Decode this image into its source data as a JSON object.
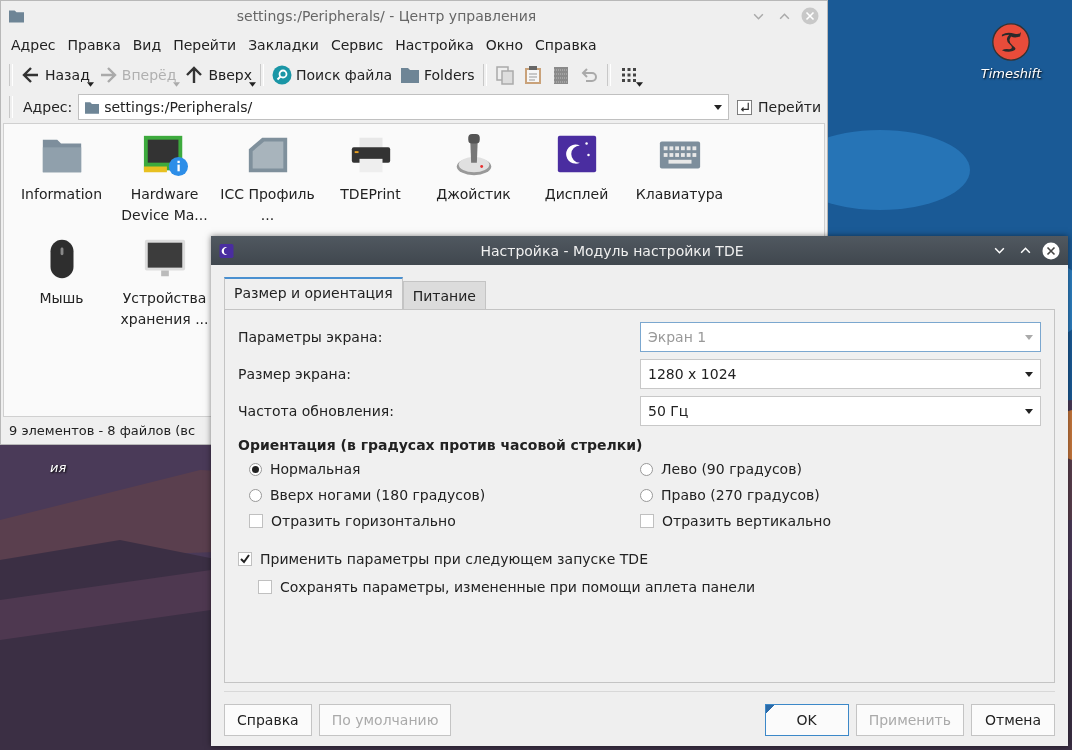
{
  "desktop": {
    "icons": [
      {
        "label": "Timeshift"
      }
    ],
    "partial_label": "ия"
  },
  "main_window": {
    "title": "settings:/Peripherals/ - Центр управления",
    "menu": [
      "Адрес",
      "Правка",
      "Вид",
      "Перейти",
      "Закладки",
      "Сервис",
      "Настройка",
      "Окно",
      "Справка"
    ],
    "toolbar_groups": [
      [
        {
          "kind": "back",
          "label": "Назад",
          "disabled": false,
          "dropdown": true
        },
        {
          "kind": "forward",
          "label": "Вперёд",
          "disabled": true,
          "dropdown": true
        },
        {
          "kind": "up",
          "label": "Вверх",
          "disabled": false,
          "dropdown": true
        }
      ],
      [
        {
          "kind": "search",
          "label": "Поиск файла",
          "disabled": false,
          "dropdown": false
        },
        {
          "kind": "folders",
          "label": "Folders",
          "disabled": false,
          "dropdown": false
        }
      ],
      [
        {
          "kind": "copy",
          "disabled": true,
          "dropdown": false
        },
        {
          "kind": "paste",
          "disabled": false,
          "dropdown": false
        },
        {
          "kind": "trash",
          "disabled": true,
          "dropdown": false
        },
        {
          "kind": "undo",
          "disabled": true,
          "dropdown": false
        }
      ],
      [
        {
          "kind": "grid",
          "disabled": false,
          "dropdown": true
        }
      ]
    ],
    "address": {
      "label": "Адрес:",
      "value": "settings:/Peripherals/",
      "go": "Перейти"
    },
    "items": [
      {
        "kind": "folder",
        "label": "Information"
      },
      {
        "kind": "hardware",
        "label": "Hardware Device Ma..."
      },
      {
        "kind": "icc",
        "label": "ICC Профиль ..."
      },
      {
        "kind": "printer",
        "label": "TDEPrint"
      },
      {
        "kind": "joystick",
        "label": "Джойстик"
      },
      {
        "kind": "display",
        "label": "Дисплей"
      },
      {
        "kind": "keyboard",
        "label": "Клавиатура"
      },
      {
        "kind": "mouse",
        "label": "Мышь"
      },
      {
        "kind": "storage",
        "label": "Устройства хранения ..."
      }
    ],
    "status": "9 элементов - 8 файлов (вс"
  },
  "dialog": {
    "title": "Настройка - Модуль настройки TDE",
    "tabs": [
      {
        "label": "Размер и ориентация",
        "selected": true
      },
      {
        "label": "Питание",
        "selected": false
      }
    ],
    "fields": [
      {
        "label": "Параметры экрана:",
        "value": "Экран 1",
        "disabled": true
      },
      {
        "label": "Размер экрана:",
        "value": "1280 x 1024",
        "disabled": false
      },
      {
        "label": "Частота обновления:",
        "value": "50 Гц",
        "disabled": false
      }
    ],
    "orientation": {
      "heading": "Ориентация (в градусах против часовой стрелки)",
      "options": [
        {
          "kind": "radio",
          "label": "Нормальная",
          "selected": true
        },
        {
          "kind": "radio",
          "label": "Лево (90 градусов)",
          "selected": false
        },
        {
          "kind": "radio",
          "label": "Вверх ногами (180 градусов)",
          "selected": false
        },
        {
          "kind": "radio",
          "label": "Право (270 градусов)",
          "selected": false
        },
        {
          "kind": "checkbox",
          "label": "Отразить горизонтально",
          "checked": false
        },
        {
          "kind": "checkbox",
          "label": "Отразить вертикально",
          "checked": false
        }
      ]
    },
    "apply": {
      "label": "Применить параметры при следующем запуске TDE",
      "checked": true
    },
    "save": {
      "label": "Сохранять параметры, измененные при помощи аплета панели",
      "checked": false
    },
    "left_buttons": [
      {
        "label": "Справка",
        "disabled": false,
        "default": false
      },
      {
        "label": "По умолчанию",
        "disabled": true,
        "default": false
      }
    ],
    "right_buttons": [
      {
        "label": "OK",
        "disabled": false,
        "default": true
      },
      {
        "label": "Применить",
        "disabled": true,
        "default": false
      },
      {
        "label": "Отмена",
        "disabled": false,
        "default": false
      }
    ]
  }
}
